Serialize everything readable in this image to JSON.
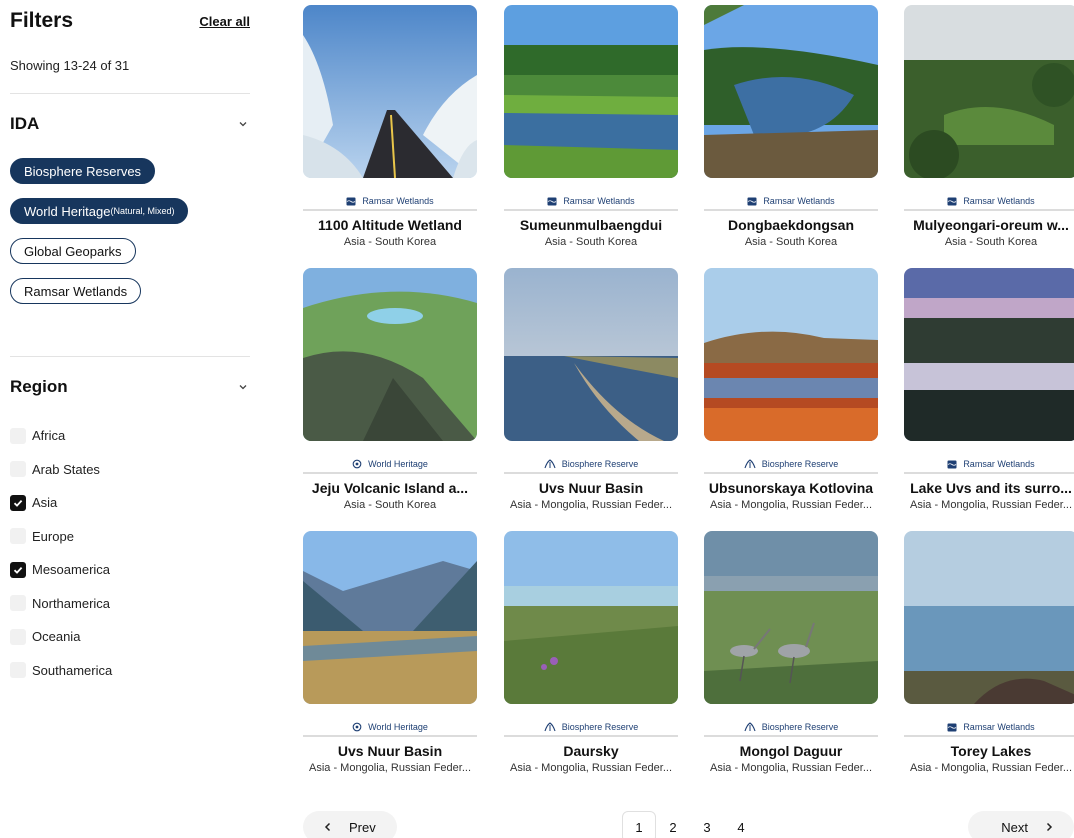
{
  "filters": {
    "title": "Filters",
    "clear_all": "Clear all",
    "showing": "Showing 13-24 of 31"
  },
  "ida": {
    "title": "IDA",
    "chips": [
      {
        "label": "Biosphere Reserves",
        "active": true
      },
      {
        "label": "World Heritage",
        "suffix": "(Natural, Mixed)",
        "active": true
      },
      {
        "label": "Global Geoparks",
        "active": false
      },
      {
        "label": "Ramsar Wetlands",
        "active": false
      }
    ]
  },
  "region": {
    "title": "Region",
    "items": [
      {
        "label": "Africa",
        "checked": false
      },
      {
        "label": "Arab States",
        "checked": false
      },
      {
        "label": "Asia",
        "checked": true
      },
      {
        "label": "Europe",
        "checked": false
      },
      {
        "label": "Mesoamerica",
        "checked": true
      },
      {
        "label": "Northamerica",
        "checked": false
      },
      {
        "label": "Oceania",
        "checked": false
      },
      {
        "label": "Southamerica",
        "checked": false
      }
    ]
  },
  "cards": [
    {
      "badge": "Ramsar Wetlands",
      "badge_icon": "wetland-icon",
      "title": "1100 Altitude Wetland",
      "location": "Asia - South Korea",
      "scene": "snow-road"
    },
    {
      "badge": "Ramsar Wetlands",
      "badge_icon": "wetland-icon",
      "title": "Sumeunmulbaengdui",
      "location": "Asia - South Korea",
      "scene": "marsh"
    },
    {
      "badge": "Ramsar Wetlands",
      "badge_icon": "wetland-icon",
      "title": "Dongbaekdongsan",
      "location": "Asia - South Korea",
      "scene": "pond"
    },
    {
      "badge": "Ramsar Wetlands",
      "badge_icon": "wetland-icon",
      "title": "Mulyeongari-oreum w...",
      "location": "Asia - South Korea",
      "scene": "forest"
    },
    {
      "badge": "World Heritage",
      "badge_icon": "heritage-icon",
      "title": "Jeju Volcanic Island a...",
      "location": "Asia - South Korea",
      "scene": "crater"
    },
    {
      "badge": "Biosphere Reserve",
      "badge_icon": "biosphere-icon",
      "title": "Uvs Nuur Basin",
      "location": "Asia - Mongolia, Russian Feder...",
      "scene": "lake-spit"
    },
    {
      "badge": "Biosphere Reserve",
      "badge_icon": "biosphere-icon",
      "title": "Ubsunorskaya Kotlovina",
      "location": "Asia - Mongolia, Russian Feder...",
      "scene": "autumn-marsh"
    },
    {
      "badge": "Ramsar Wetlands",
      "badge_icon": "wetland-icon",
      "title": "Lake Uvs and its surro...",
      "location": "Asia - Mongolia, Russian Feder...",
      "scene": "dusk-lake"
    },
    {
      "badge": "World Heritage",
      "badge_icon": "heritage-icon",
      "title": "Uvs Nuur Basin",
      "location": "Asia - Mongolia, Russian Feder...",
      "scene": "valley"
    },
    {
      "badge": "Biosphere Reserve",
      "badge_icon": "biosphere-icon",
      "title": "Daursky",
      "location": "Asia - Mongolia, Russian Feder...",
      "scene": "steppe-lake"
    },
    {
      "badge": "Biosphere Reserve",
      "badge_icon": "biosphere-icon",
      "title": "Mongol Daguur",
      "location": "Asia - Mongolia, Russian Feder...",
      "scene": "cranes"
    },
    {
      "badge": "Ramsar Wetlands",
      "badge_icon": "wetland-icon",
      "title": "Torey Lakes",
      "location": "Asia - Mongolia, Russian Feder...",
      "scene": "calm-lake"
    }
  ],
  "pagination": {
    "prev": "Prev",
    "next": "Next",
    "pages": [
      "1",
      "2",
      "3",
      "4"
    ],
    "current": "1"
  },
  "colors": {
    "chip_active": "#17365d",
    "badge_text": "#1e3f73"
  }
}
